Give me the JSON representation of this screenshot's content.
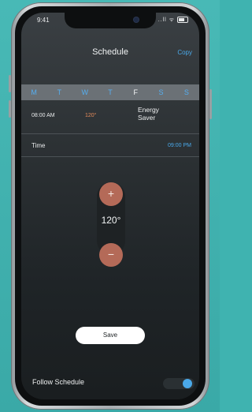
{
  "status_bar": {
    "time": "9:41",
    "icons": "..ll ᯤ"
  },
  "header": {
    "title": "Schedule",
    "copy_label": "Copy"
  },
  "days": [
    {
      "label": "M",
      "active": false
    },
    {
      "label": "T",
      "active": false
    },
    {
      "label": "W",
      "active": false
    },
    {
      "label": "T",
      "active": false
    },
    {
      "label": "F",
      "active": true
    },
    {
      "label": "S",
      "active": false
    },
    {
      "label": "S",
      "active": false
    }
  ],
  "entry": {
    "time": "08:00 AM",
    "temperature": "120°",
    "mode_line1": "Energy",
    "mode_line2": "Saver"
  },
  "time_row": {
    "label": "Time",
    "value": "09:00 PM"
  },
  "stepper": {
    "plus": "+",
    "minus": "−",
    "value": "120°"
  },
  "save_label": "Save",
  "follow_schedule": {
    "label": "Follow Schedule",
    "enabled": true
  },
  "colors": {
    "accent_blue": "#4aa8e8",
    "temp_orange": "#e58b5a",
    "stepper_button": "#b46a58",
    "day_bar": "#6b7176"
  }
}
